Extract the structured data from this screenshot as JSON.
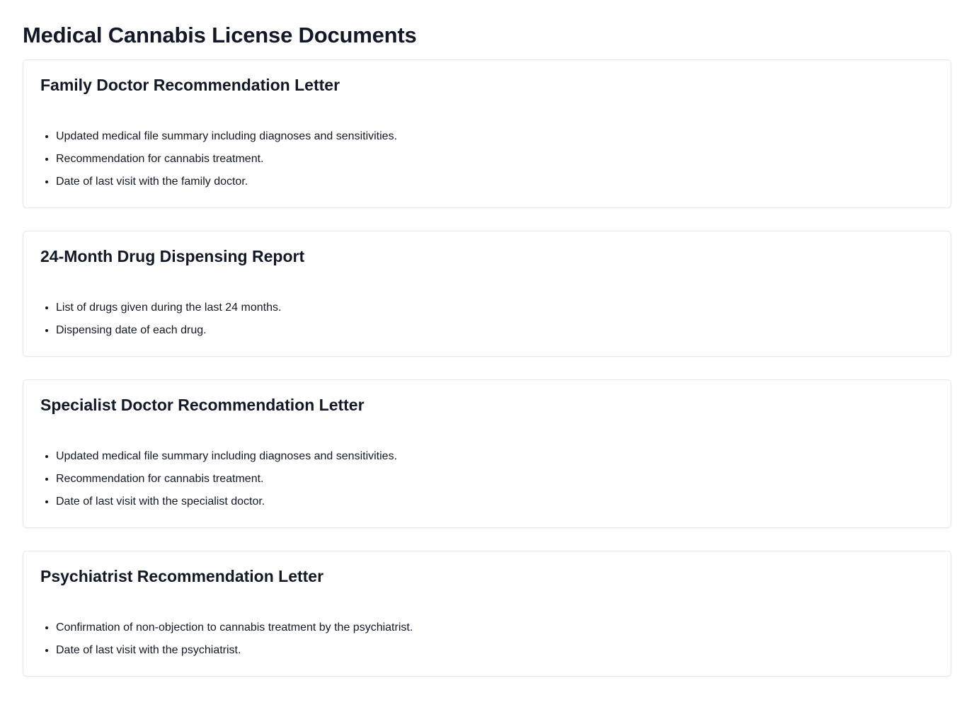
{
  "page": {
    "title": "Medical Cannabis License Documents"
  },
  "documents": [
    {
      "title": "Family Doctor Recommendation Letter",
      "items": [
        "Updated medical file summary including diagnoses and sensitivities.",
        "Recommendation for cannabis treatment.",
        "Date of last visit with the family doctor."
      ]
    },
    {
      "title": "24-Month Drug Dispensing Report",
      "items": [
        "List of drugs given during the last 24 months.",
        "Dispensing date of each drug."
      ]
    },
    {
      "title": "Specialist Doctor Recommendation Letter",
      "items": [
        "Updated medical file summary including diagnoses and sensitivities.",
        "Recommendation for cannabis treatment.",
        "Date of last visit with the specialist doctor."
      ]
    },
    {
      "title": "Psychiatrist Recommendation Letter",
      "items": [
        "Confirmation of non-objection to cannabis treatment by the psychiatrist.",
        "Date of last visit with the psychiatrist."
      ]
    }
  ]
}
